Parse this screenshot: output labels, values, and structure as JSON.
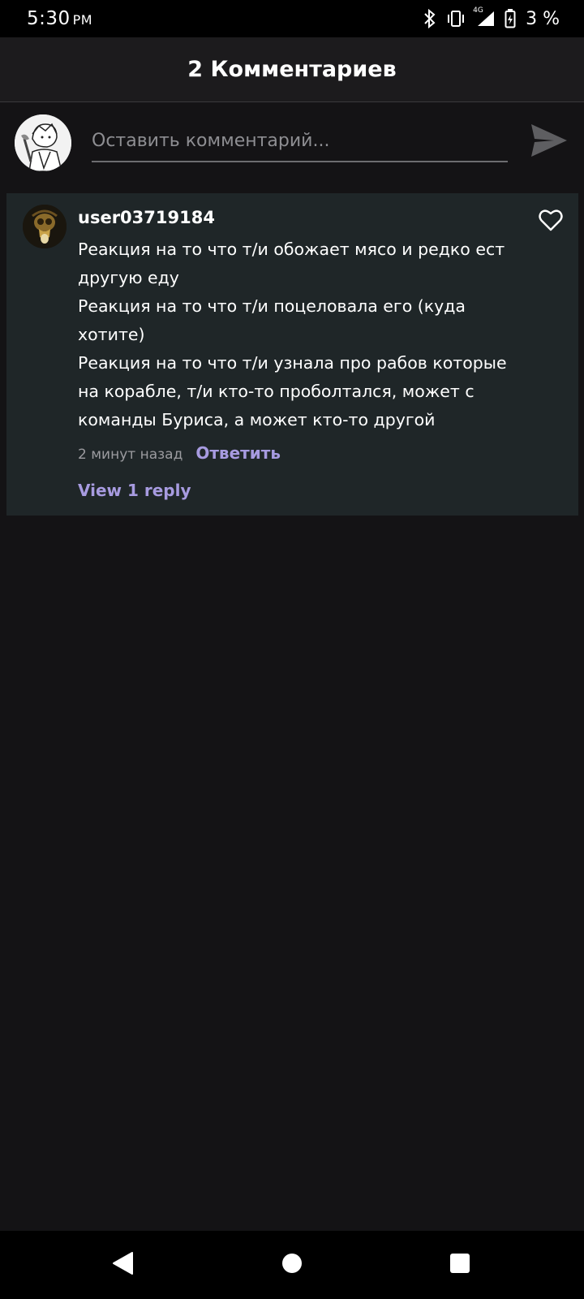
{
  "status_bar": {
    "time": "5:30",
    "ampm": "PM",
    "network": "4G",
    "battery": "3 %"
  },
  "header": {
    "title": "2 Комментариев"
  },
  "compose": {
    "placeholder": "Оставить комментарий..."
  },
  "comments": [
    {
      "username": "user03719184",
      "text": "Реакция на то что т/и обожает мясо и редко ест другую еду\nРеакция на то что т/и поцеловала его (куда хотите)\nРеакция на то что т/и узнала про рабов которые на корабле, т/и кто-то проболтался, может с команды Буриса, а может кто-то другой",
      "time": "2 минут назад",
      "reply_label": "Ответить",
      "view_replies_label": "View 1 reply"
    }
  ],
  "colors": {
    "background": "#141315",
    "card": "#1f2628",
    "accent": "#a79be0"
  },
  "icons": {
    "bluetooth": "bluetooth-icon",
    "vibrate": "vibrate-icon",
    "signal": "signal-icon",
    "battery": "battery-charging-icon",
    "send": "send-icon",
    "like": "heart-outline-icon",
    "back": "nav-back-icon",
    "home": "nav-home-icon",
    "recents": "nav-recents-icon"
  }
}
